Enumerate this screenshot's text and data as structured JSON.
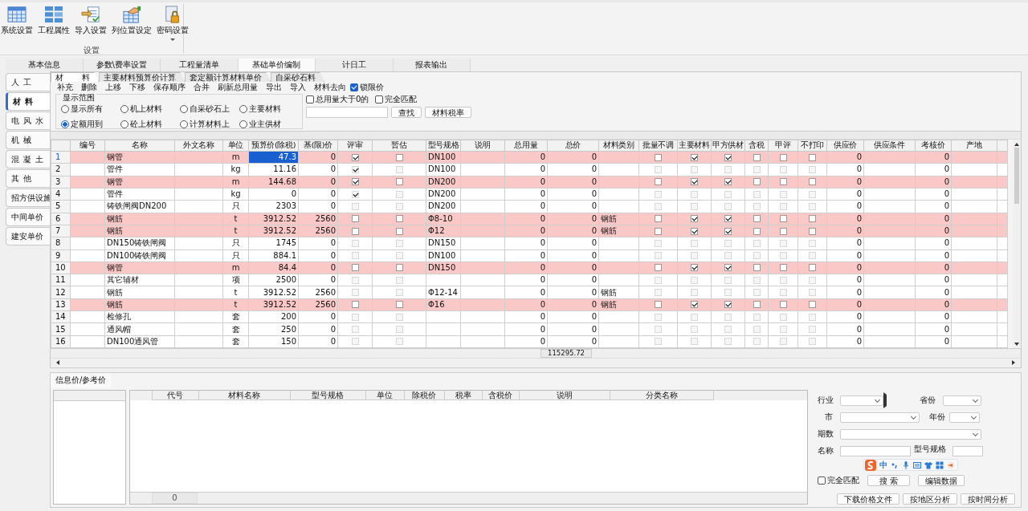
{
  "toolbar": {
    "buttons": [
      {
        "label": "系统设置",
        "kind": "grid",
        "dropdown": false
      },
      {
        "label": "工程属性",
        "kind": "tiles",
        "dropdown": false
      },
      {
        "label": "导入设置",
        "kind": "import",
        "dropdown": false
      },
      {
        "label": "列位置设定",
        "kind": "hand",
        "dropdown": false
      },
      {
        "label": "密码设置",
        "kind": "lock",
        "dropdown": true
      }
    ],
    "group_label": "设置"
  },
  "main_tabs": [
    {
      "label": "基本信息",
      "selected": false
    },
    {
      "label": "参数\\费率设置",
      "selected": false
    },
    {
      "label": "工程量清单",
      "selected": false
    },
    {
      "label": "基础单价编制",
      "selected": true
    },
    {
      "label": "计日工",
      "selected": false
    },
    {
      "label": "报表输出",
      "selected": false
    }
  ],
  "side_tabs": [
    {
      "label": "人 工",
      "selected": false
    },
    {
      "label": "材 料",
      "selected": true
    },
    {
      "label": "电 风 水",
      "selected": false
    },
    {
      "label": "机 械",
      "selected": false
    },
    {
      "label": "混 凝 土",
      "selected": false
    },
    {
      "label": "其 他",
      "selected": false
    },
    {
      "label": "招方供设施",
      "selected": false
    },
    {
      "label": "中间单价",
      "selected": false
    },
    {
      "label": "建安单价",
      "selected": false
    }
  ],
  "sub_tabs": [
    {
      "label": "材 料",
      "selected": true
    },
    {
      "label": "主要材料预算价计算",
      "selected": false
    },
    {
      "label": "套定额计算材料单价",
      "selected": false
    },
    {
      "label": "自采砂石料",
      "selected": false
    }
  ],
  "actions": [
    "补充",
    "删除",
    "上移",
    "下移",
    "保存顺序",
    "合并",
    "刷新总用量",
    "导出",
    "导入",
    "材料去向"
  ],
  "lock_price": {
    "label": "锁限价",
    "checked": true
  },
  "filter": {
    "title": "显示范围",
    "radios": [
      {
        "label": "显示所有",
        "selected": false
      },
      {
        "label": "机上材料",
        "selected": false
      },
      {
        "label": "自采砂石上",
        "selected": false
      },
      {
        "label": "主要材料",
        "selected": false
      },
      {
        "label": "定额用到",
        "selected": true
      },
      {
        "label": "砼上材料",
        "selected": false
      },
      {
        "label": "计算材料上",
        "selected": false
      },
      {
        "label": "业主供材",
        "selected": false
      }
    ],
    "checks": [
      {
        "label": "总用量大于0的",
        "checked": false
      },
      {
        "label": "完全匹配",
        "checked": false
      }
    ],
    "find_button": "查找",
    "tax_button": "材料税率"
  },
  "table": {
    "columns": [
      "编号",
      "名称",
      "外文名称",
      "单位",
      "预算价(除税)",
      "基(限)价",
      "评审",
      "暂估",
      "型号规格",
      "说明",
      "总用量",
      "总价",
      "材料类别",
      "批量不调",
      "主要材料",
      "甲方供材",
      "含税",
      "甲评",
      "不打印",
      "供应价",
      "供应条件",
      "考核价",
      "产地"
    ],
    "rows": [
      {
        "no": "1",
        "selected": true,
        "highlighted": true,
        "cells": [
          null,
          "钢管",
          null,
          "m",
          "47.3",
          "0",
          true,
          false,
          "DN100",
          null,
          "0",
          "0",
          null,
          false,
          true,
          true,
          false,
          false,
          false,
          "0",
          null,
          "0",
          null
        ]
      },
      {
        "no": "2",
        "selected": false,
        "highlighted": false,
        "cells": [
          null,
          "管件",
          null,
          "kg",
          "11.16",
          "0",
          true,
          false,
          "DN100",
          null,
          "0",
          "0",
          null,
          false,
          false,
          false,
          false,
          false,
          false,
          "0",
          null,
          "0",
          null
        ]
      },
      {
        "no": "3",
        "selected": false,
        "highlighted": true,
        "cells": [
          null,
          "钢管",
          null,
          "m",
          "144.68",
          "0",
          true,
          false,
          "DN200",
          null,
          "0",
          "0",
          null,
          false,
          true,
          true,
          false,
          false,
          false,
          "0",
          null,
          "0",
          null
        ]
      },
      {
        "no": "4",
        "selected": false,
        "highlighted": false,
        "cells": [
          null,
          "管件",
          null,
          "kg",
          "0",
          "0",
          true,
          false,
          "DN200",
          null,
          "0",
          "0",
          null,
          false,
          false,
          false,
          false,
          false,
          false,
          "0",
          null,
          "0",
          null
        ]
      },
      {
        "no": "5",
        "selected": false,
        "highlighted": false,
        "cells": [
          null,
          "铸铁闸阀DN200",
          null,
          "只",
          "2303",
          "0",
          false,
          false,
          "DN200",
          null,
          "0",
          "0",
          null,
          false,
          false,
          false,
          false,
          false,
          false,
          "0",
          null,
          "0",
          null
        ]
      },
      {
        "no": "6",
        "selected": false,
        "highlighted": true,
        "cells": [
          null,
          "钢筋",
          null,
          "t",
          "3912.52",
          "2560",
          false,
          false,
          "Φ8-10",
          null,
          "0",
          "0",
          "钢筋",
          false,
          true,
          true,
          false,
          false,
          false,
          "0",
          null,
          "0",
          null
        ]
      },
      {
        "no": "7",
        "selected": false,
        "highlighted": true,
        "cells": [
          null,
          "钢筋",
          null,
          "t",
          "3912.52",
          "2560",
          false,
          false,
          "Φ12",
          null,
          "0",
          "0",
          "钢筋",
          false,
          true,
          true,
          false,
          false,
          false,
          "0",
          null,
          "0",
          null
        ]
      },
      {
        "no": "8",
        "selected": false,
        "highlighted": false,
        "cells": [
          null,
          "DN150铸铁闸阀",
          null,
          "只",
          "1745",
          "0",
          false,
          false,
          "DN150",
          null,
          "0",
          "0",
          null,
          false,
          false,
          false,
          false,
          false,
          false,
          "0",
          null,
          "0",
          null
        ]
      },
      {
        "no": "9",
        "selected": false,
        "highlighted": false,
        "cells": [
          null,
          "DN100铸铁闸阀",
          null,
          "只",
          "884.1",
          "0",
          false,
          false,
          "DN100",
          null,
          "0",
          "0",
          null,
          false,
          false,
          false,
          false,
          false,
          false,
          "0",
          null,
          "0",
          null
        ]
      },
      {
        "no": "10",
        "selected": false,
        "highlighted": true,
        "cells": [
          null,
          "钢管",
          null,
          "m",
          "84.4",
          "0",
          false,
          false,
          "DN150",
          null,
          "0",
          "0",
          null,
          false,
          true,
          true,
          false,
          false,
          false,
          "0",
          null,
          "0",
          null
        ]
      },
      {
        "no": "11",
        "selected": false,
        "highlighted": false,
        "cells": [
          null,
          "其它辅材",
          null,
          "项",
          "2500",
          "0",
          false,
          false,
          null,
          null,
          "0",
          "0",
          null,
          false,
          false,
          false,
          false,
          false,
          false,
          "0",
          null,
          "0",
          null
        ]
      },
      {
        "no": "12",
        "selected": false,
        "highlighted": false,
        "cells": [
          null,
          "钢筋",
          null,
          "t",
          "3912.52",
          "2560",
          false,
          false,
          "Φ12-14",
          null,
          "0",
          "0",
          "钢筋",
          false,
          false,
          false,
          false,
          false,
          false,
          "0",
          null,
          "0",
          null
        ]
      },
      {
        "no": "13",
        "selected": false,
        "highlighted": true,
        "cells": [
          null,
          "钢筋",
          null,
          "t",
          "3912.52",
          "2560",
          false,
          false,
          "Φ16",
          null,
          "0",
          "0",
          "钢筋",
          false,
          true,
          true,
          false,
          false,
          false,
          "0",
          null,
          "0",
          null
        ]
      },
      {
        "no": "14",
        "selected": false,
        "highlighted": false,
        "cells": [
          null,
          "检修孔",
          null,
          "套",
          "200",
          "0",
          false,
          false,
          null,
          null,
          "0",
          "0",
          null,
          false,
          false,
          false,
          false,
          false,
          false,
          "0",
          null,
          "0",
          null
        ]
      },
      {
        "no": "15",
        "selected": false,
        "highlighted": false,
        "cells": [
          null,
          "通风帽",
          null,
          "套",
          "250",
          "0",
          false,
          false,
          null,
          null,
          "0",
          "0",
          null,
          false,
          false,
          false,
          false,
          false,
          false,
          "0",
          null,
          "0",
          null
        ]
      },
      {
        "no": "16",
        "selected": false,
        "highlighted": false,
        "cells": [
          null,
          "DN100通风管",
          null,
          "套",
          "150",
          "0",
          false,
          false,
          null,
          null,
          "0",
          "0",
          null,
          false,
          false,
          false,
          false,
          false,
          false,
          "0",
          null,
          "0",
          null
        ]
      }
    ],
    "total": "115295.72"
  },
  "bottom": {
    "tab": "信息价/参考价",
    "columns": [
      "代号",
      "材料名称",
      "型号规格",
      "单位",
      "除税价",
      "税率",
      "含税价",
      "说明",
      "分类名称"
    ],
    "count": "0",
    "form": {
      "industry": "行业",
      "province": "省份",
      "city": "市",
      "year": "年份",
      "period": "期数",
      "name": "名称",
      "spec": "型号规格",
      "exact": {
        "label": "完全匹配",
        "checked": false
      },
      "search_button": "搜 索",
      "edit_button": "编辑数据",
      "buttons": [
        "下载价格文件",
        "按地区分析",
        "按时间分析"
      ]
    }
  },
  "ime_bar": {
    "mode": "中"
  }
}
